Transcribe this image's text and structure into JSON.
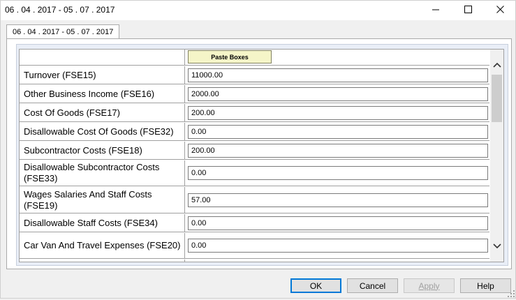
{
  "window": {
    "title": "06 . 04 . 2017 - 05 . 07 . 2017"
  },
  "tabs": [
    {
      "label": "06 . 04 . 2017 - 05 . 07 . 2017",
      "active": true
    }
  ],
  "grid": {
    "paste_label": "Paste Boxes",
    "rows": [
      {
        "label": "Turnover (FSE15)",
        "value": "11000.00"
      },
      {
        "label": "Other Business Income (FSE16)",
        "value": "2000.00"
      },
      {
        "label": "Cost Of Goods (FSE17)",
        "value": "200.00"
      },
      {
        "label": "Disallowable Cost Of Goods (FSE32)",
        "value": "0.00"
      },
      {
        "label": "Subcontractor Costs (FSE18)",
        "value": "200.00"
      },
      {
        "label": "Disallowable Subcontractor Costs (FSE33)",
        "value": "0.00"
      },
      {
        "label": "Wages Salaries And Staff Costs (FSE19)",
        "value": "57.00"
      },
      {
        "label": "Disallowable Staff Costs (FSE34)",
        "value": "0.00"
      },
      {
        "label": "Car Van And Travel Expenses (FSE20)",
        "value": "0.00"
      }
    ]
  },
  "buttons": {
    "ok": "OK",
    "cancel": "Cancel",
    "apply": "Apply",
    "help": "Help"
  },
  "icons": {
    "minimize": "minimize-icon",
    "maximize": "maximize-icon",
    "close": "close-icon",
    "scroll_up": "chevron-up-icon",
    "scroll_down": "chevron-down-icon",
    "resize": "resize-grip-icon"
  },
  "colors": {
    "paste_button_bg": "#f5f5c8",
    "default_button_border": "#0078d7",
    "scroll_thumb": "#cdcdcd",
    "frame_bg": "#e9eef7"
  }
}
